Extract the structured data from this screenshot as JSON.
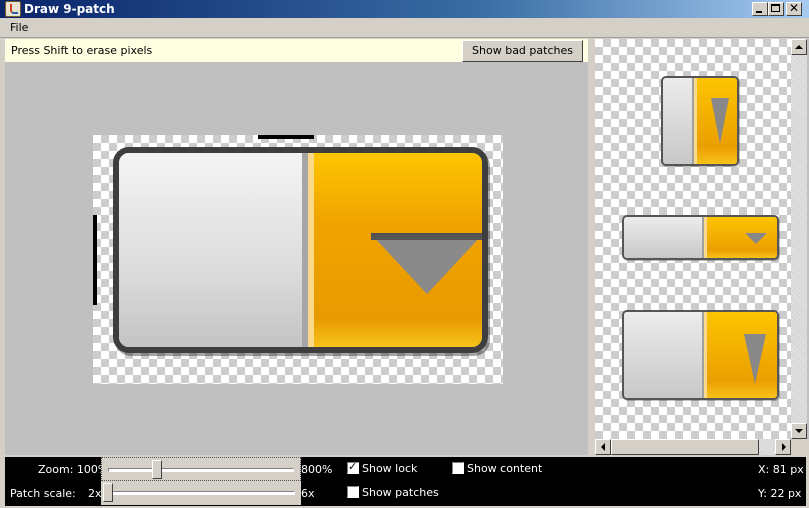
{
  "window": {
    "title": "Draw 9-patch",
    "controls": {
      "minimize": "_",
      "maximize": "□",
      "close": "✕"
    }
  },
  "menu": {
    "items": [
      "File"
    ]
  },
  "editor": {
    "hint": "Press Shift to erase pixels",
    "bad_patches_button": "Show bad patches"
  },
  "preview": {
    "items": [
      {
        "name": "square-preview"
      },
      {
        "name": "wide-short-preview"
      },
      {
        "name": "wide-tall-preview"
      }
    ]
  },
  "controls": {
    "zoom_label": "Zoom: 100%",
    "zoom_max_label": "800%",
    "zoom_value_percent": 100,
    "zoom_range_percent": [
      100,
      800
    ],
    "patch_scale_label": "Patch scale:",
    "patch_scale_min_label": "2x",
    "patch_scale_max_label": "6x",
    "patch_scale_value": 2,
    "show_lock": {
      "label": "Show lock",
      "checked": true
    },
    "show_content": {
      "label": "Show content",
      "checked": false
    },
    "show_patches": {
      "label": "Show patches",
      "checked": false
    },
    "x_readout": "X: 81 px",
    "y_readout": "Y: 22 px"
  },
  "colors": {
    "titlebar_start": "#0a246a",
    "titlebar_end": "#a6caf0",
    "hint_background": "#ffffe1",
    "button_orange": "#f1a400",
    "button_gray": "#dcdcdc",
    "canvas_background": "#c0c0c0"
  }
}
